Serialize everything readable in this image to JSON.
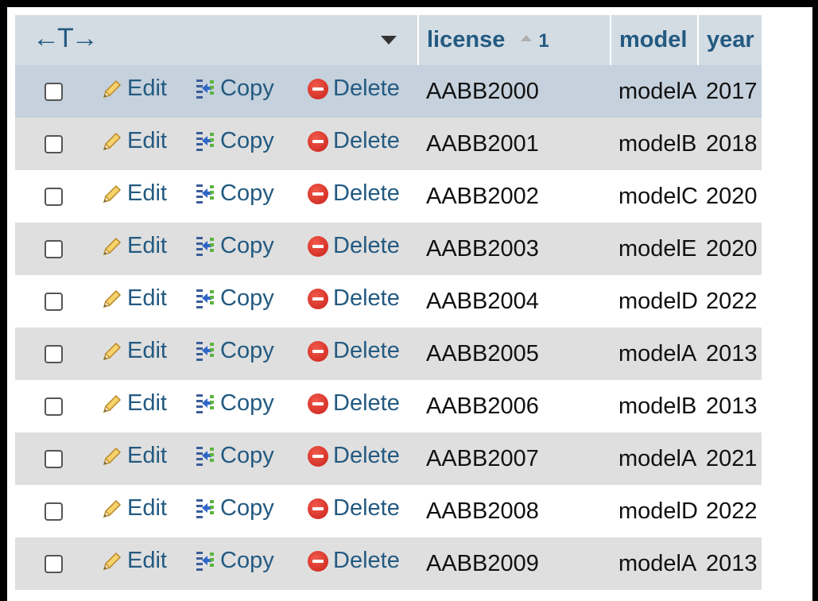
{
  "header": {
    "nav_arrows": "←T→",
    "columns": {
      "license": "license",
      "license_sort_order": "1",
      "model": "model",
      "year": "year"
    }
  },
  "actions": {
    "edit_label": "Edit",
    "copy_label": "Copy",
    "delete_label": "Delete"
  },
  "rows": [
    {
      "license": "AABB2000",
      "model": "modelA",
      "year": "2017",
      "selected": false,
      "highlighted": true
    },
    {
      "license": "AABB2001",
      "model": "modelB",
      "year": "2018",
      "selected": false
    },
    {
      "license": "AABB2002",
      "model": "modelC",
      "year": "2020",
      "selected": false
    },
    {
      "license": "AABB2003",
      "model": "modelE",
      "year": "2020",
      "selected": false
    },
    {
      "license": "AABB2004",
      "model": "modelD",
      "year": "2022",
      "selected": false
    },
    {
      "license": "AABB2005",
      "model": "modelA",
      "year": "2013",
      "selected": false
    },
    {
      "license": "AABB2006",
      "model": "modelB",
      "year": "2013",
      "selected": false
    },
    {
      "license": "AABB2007",
      "model": "modelA",
      "year": "2021",
      "selected": false
    },
    {
      "license": "AABB2008",
      "model": "modelD",
      "year": "2022",
      "selected": false
    },
    {
      "license": "AABB2009",
      "model": "modelA",
      "year": "2013",
      "selected": false
    }
  ],
  "colors": {
    "header_bg": "#d3dce3",
    "link": "#235a81",
    "row_even": "#dfdfdf",
    "row_highlight": "#c5d1dc",
    "delete_icon": "#d9302a"
  },
  "icons": {
    "edit": "pencil-icon",
    "copy": "copy-icon",
    "delete": "delete-icon",
    "sort": "sort-ascending-icon",
    "column_menu": "dropdown-triangle-icon"
  }
}
